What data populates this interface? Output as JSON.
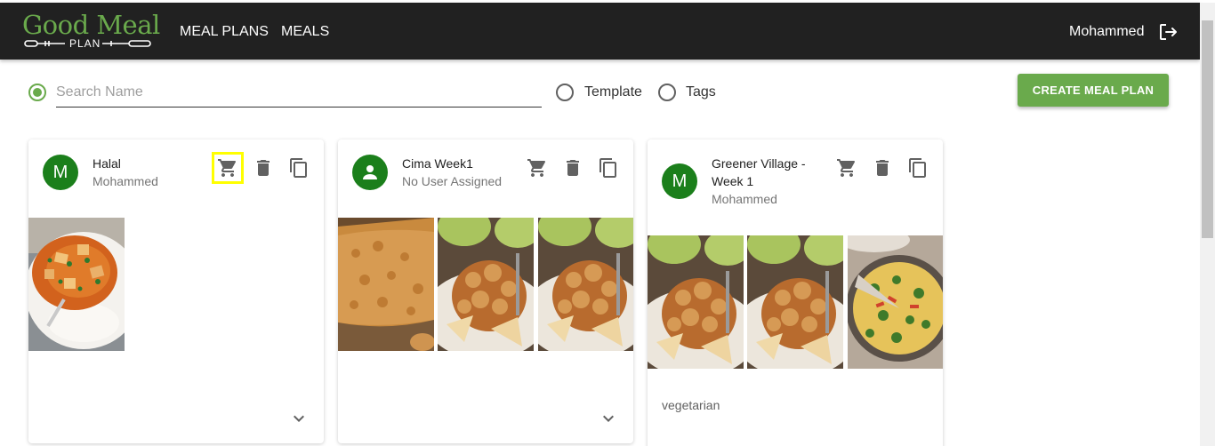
{
  "header": {
    "logo_title": "Good Meal",
    "logo_subtitle": "PLAN",
    "nav": [
      "MEAL PLANS",
      "MEALS"
    ],
    "user_name": "Mohammed"
  },
  "filters": {
    "search_placeholder": "Search Name",
    "options": [
      {
        "label": "Search Name",
        "selected": true
      },
      {
        "label": "Template",
        "selected": false
      },
      {
        "label": "Tags",
        "selected": false
      }
    ],
    "accent_color": "#6aaa4c"
  },
  "create_button_label": "CREATE MEAL PLAN",
  "cards": [
    {
      "title": "Halal",
      "subtitle": "Mohammed",
      "avatar_letter": "M",
      "images": [
        "curry-with-rice"
      ],
      "tags": "",
      "expanded_indicator": "chevron-down-icon"
    },
    {
      "title": "Cima Week1",
      "subtitle": "No User Assigned",
      "avatar_icon": "person-icon",
      "images": [
        "oat-bake",
        "apple-crumble",
        "apple-crumble"
      ],
      "tags": "",
      "expanded_indicator": "chevron-down-icon"
    },
    {
      "title": "Greener Village - Week 1",
      "subtitle": "Mohammed",
      "avatar_letter": "M",
      "images": [
        "apple-crumble",
        "apple-crumble",
        "spinach-frittata"
      ],
      "tags": "vegetarian"
    }
  ],
  "colors": {
    "topbar": "#212121",
    "avatar": "#1b7f1b",
    "brand_green": "#6aaa4c",
    "highlight": "#ffff00"
  }
}
